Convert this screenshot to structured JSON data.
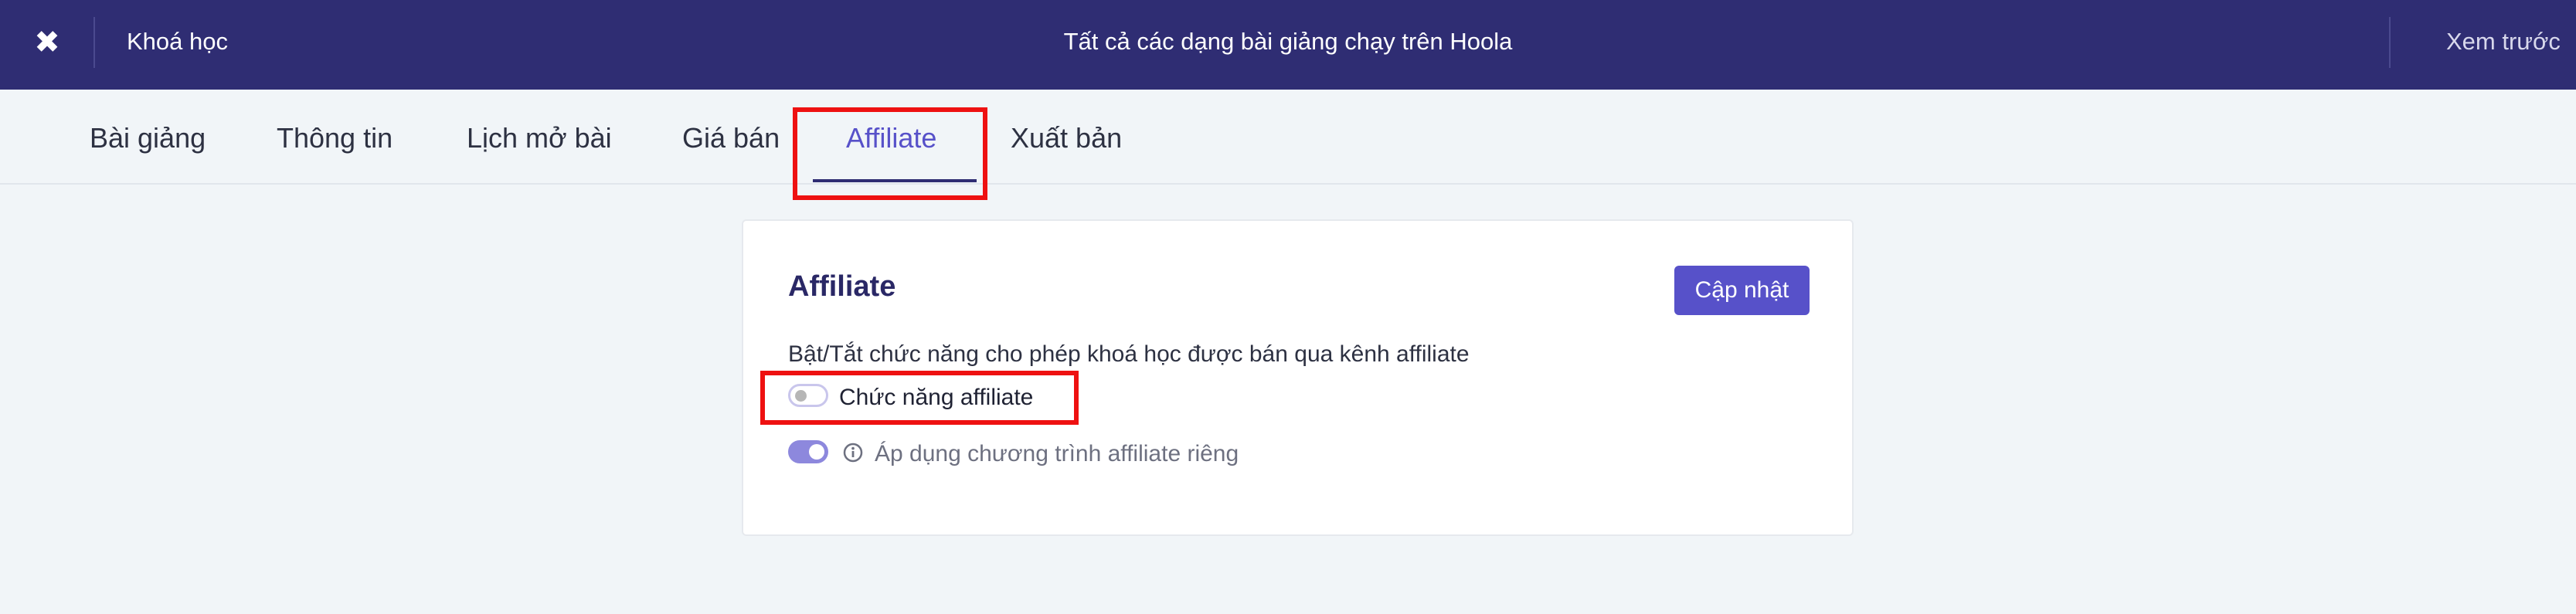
{
  "topbar": {
    "close_icon": "close-icon",
    "close_glyph": "✖",
    "course_link": "Khoá học",
    "title": "Tất cả các dạng bài giảng chạy trên Hoola",
    "preview_link": "Xem trước"
  },
  "tabs": [
    {
      "label": "Bài giảng",
      "active": false
    },
    {
      "label": "Thông tin",
      "active": false
    },
    {
      "label": "Lịch mở bài",
      "active": false
    },
    {
      "label": "Giá bán",
      "active": false
    },
    {
      "label": "Affiliate",
      "active": true
    },
    {
      "label": "Xuất bản",
      "active": false
    }
  ],
  "card": {
    "title": "Affiliate",
    "update_button": "Cập nhật",
    "description": "Bật/Tắt chức năng cho phép khoá học được bán qua kênh affiliate",
    "toggles": [
      {
        "label": "Chức năng affiliate",
        "on": false
      },
      {
        "label": "Áp dụng chương trình affiliate riêng",
        "on": true,
        "icon": "info-icon"
      }
    ]
  },
  "colors": {
    "topbar": "#2f2d73",
    "accent": "#5751c9",
    "highlight": "#ee1111",
    "background": "#f1f5f8"
  }
}
